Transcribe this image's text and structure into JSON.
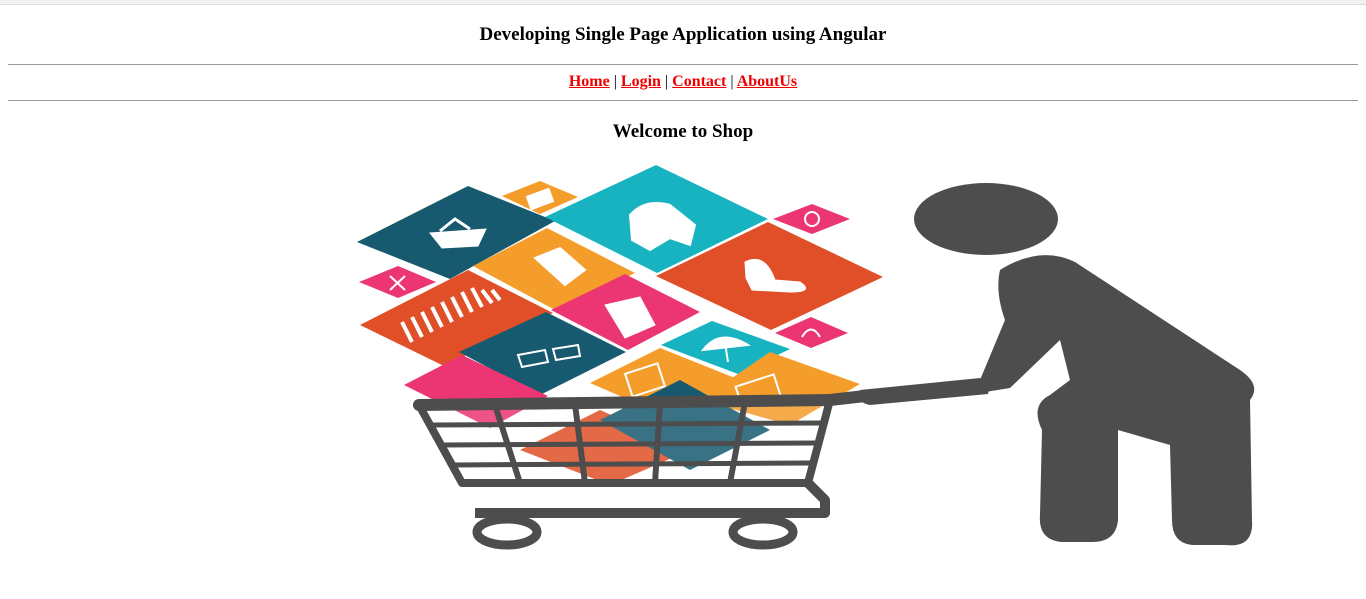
{
  "header": {
    "title": "Developing Single Page Application using Angular"
  },
  "nav": {
    "links": [
      {
        "label": "Home"
      },
      {
        "label": "Login"
      },
      {
        "label": "Contact"
      },
      {
        "label": "AboutUs"
      }
    ],
    "separator": "|"
  },
  "main": {
    "heading": "Welcome to Shop"
  },
  "colors": {
    "link": "#ee0000",
    "teal": "#17b3c1",
    "navy": "#175a70",
    "orange": "#f59d2b",
    "red_orange": "#e04f27",
    "pink": "#ec3573",
    "figure_gray": "#4d4d4d"
  }
}
